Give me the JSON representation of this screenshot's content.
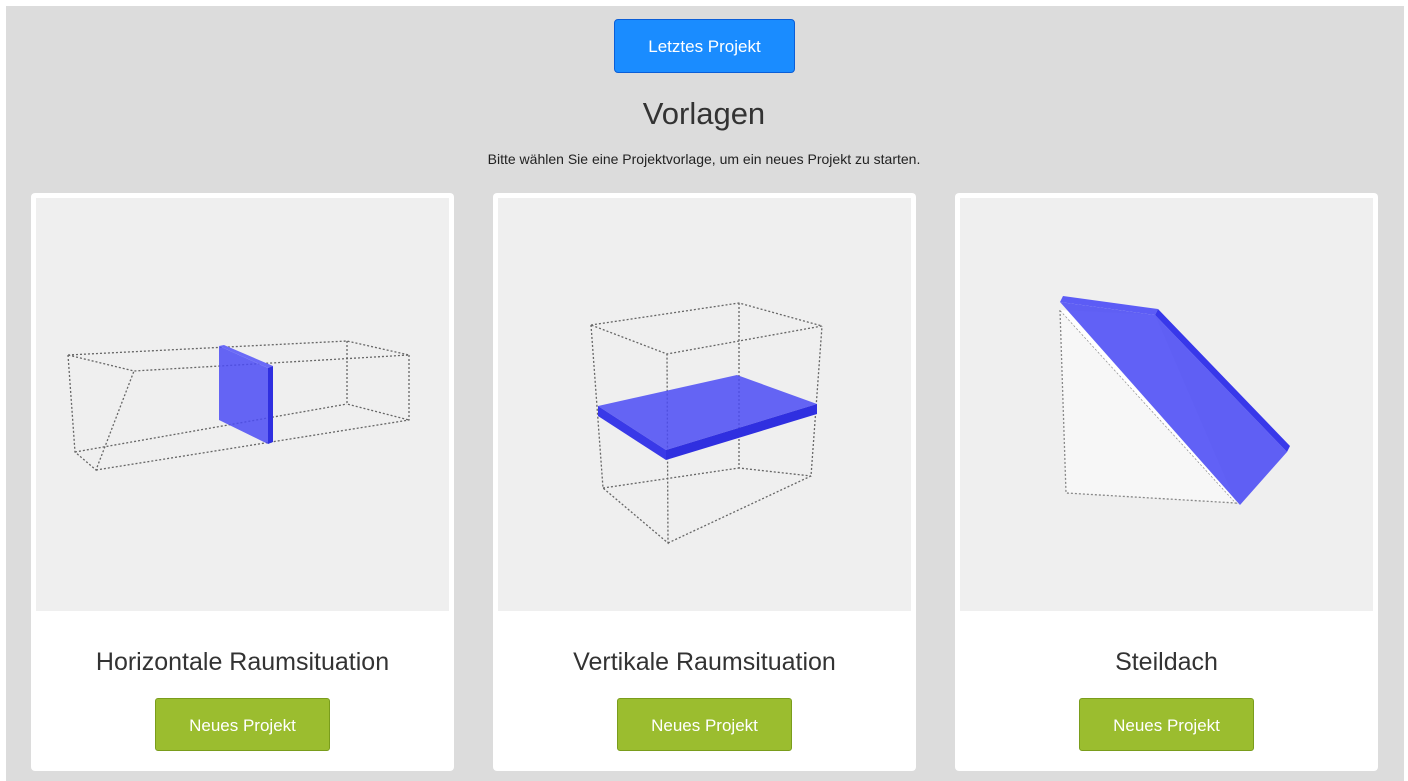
{
  "header": {
    "last_project_label": "Letztes Projekt",
    "title": "Vorlagen",
    "subtitle": "Bitte wählen Sie eine Projektvorlage, um ein neues Projekt zu starten."
  },
  "templates": [
    {
      "title": "Horizontale Raumsituation",
      "button_label": "Neues Projekt",
      "preview_icon": "horizontal-room-preview"
    },
    {
      "title": "Vertikale Raumsituation",
      "button_label": "Neues Projekt",
      "preview_icon": "vertical-room-preview"
    },
    {
      "title": "Steildach",
      "button_label": "Neues Projekt",
      "preview_icon": "steep-roof-preview"
    }
  ],
  "colors": {
    "background": "#dcdcdc",
    "primary_button": "#1a8cff",
    "success_button": "#9bbd2f",
    "preview_background": "#efefef",
    "model_blue": "#4b4bf5"
  }
}
